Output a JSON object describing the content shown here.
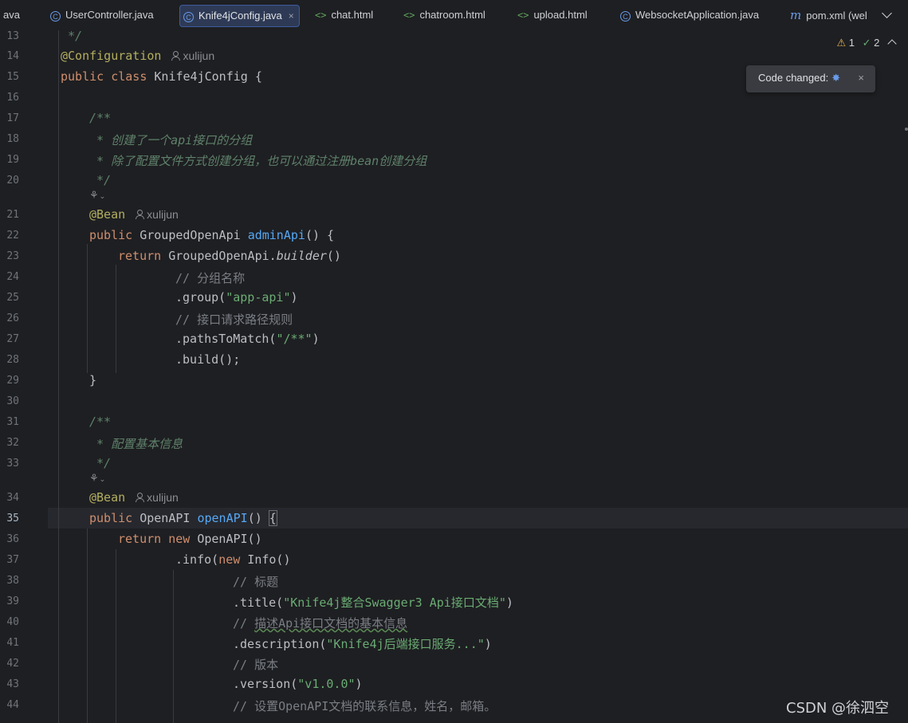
{
  "tabs": [
    {
      "label": "ava",
      "icon": "",
      "active": false
    },
    {
      "label": "UserController.java",
      "icon": "java-class-icon",
      "active": false
    },
    {
      "label": "Knife4jConfig.java",
      "icon": "java-class-icon",
      "active": true
    },
    {
      "label": "chat.html",
      "icon": "html-file-icon",
      "active": false
    },
    {
      "label": "chatroom.html",
      "icon": "html-file-icon",
      "active": false
    },
    {
      "label": "upload.html",
      "icon": "html-file-icon",
      "active": false
    },
    {
      "label": "WebsocketApplication.java",
      "icon": "java-class-icon",
      "active": false
    },
    {
      "label": "pom.xml (wel",
      "icon": "maven-icon",
      "active": false
    }
  ],
  "icons": {
    "class": "C",
    "html": "<>",
    "maven": "m",
    "close": "×",
    "lens": "⚘",
    "chevron": "⌄"
  },
  "inspections": {
    "warnings": "1",
    "checks": "2"
  },
  "toast": {
    "text": "Code changed:"
  },
  "watermark": "CSDN @徐泗空",
  "gutter": {
    "line_numbers": [
      "13",
      "14",
      "15",
      "16",
      "17",
      "18",
      "19",
      "20",
      "21",
      "22",
      "23",
      "24",
      "25",
      "26",
      "27",
      "28",
      "29",
      "30",
      "31",
      "32",
      "33",
      "34",
      "35",
      "36",
      "37",
      "38",
      "39",
      "40",
      "41",
      "42",
      "43",
      "44"
    ],
    "current_line": "35"
  },
  "code": {
    "l13": " */",
    "l14_ann": "@Configuration",
    "author": "xulijun",
    "l15_kw": "public class",
    "l15_rest": " Knife4jConfig {",
    "l17": "/**",
    "l18": " * 创建了一个api接口的分组",
    "l19": " * 除了配置文件方式创建分组，也可以通过注册bean创建分组",
    "l20": " */",
    "bean": "@Bean",
    "l22_kw": "public",
    "l22_type": " GroupedOpenApi ",
    "l22_fn": "adminApi",
    "l22_rest": "() {",
    "return_kw": "return",
    "l23_rest": " GroupedOpenApi.",
    "l23_it": "builder",
    "l23_end": "()",
    "l24": "// 分组名称",
    "l25_a": ".group(",
    "l25_s": "\"app-api\"",
    "l25_b": ")",
    "l26": "// 接口请求路径规则",
    "l27_a": ".pathsToMatch(",
    "l27_s": "\"/**\"",
    "l27_b": ")",
    "l28": ".build();",
    "l29": "}",
    "l31": "/**",
    "l32": " * 配置基本信息",
    "l33": " */",
    "l35_kw": "public",
    "l35_type": " OpenAPI ",
    "l35_fn": "openAPI",
    "l35_paren": "() ",
    "l35_brace": "{",
    "l36_new": "new",
    "l36_rest": " OpenAPI()",
    "l37_a": ".info(",
    "l37_new": "new",
    "l37_b": " Info()",
    "l38": "// 标题",
    "l39_a": ".title(",
    "l39_s": "\"Knife4j整合Swagger3 Api接口文档\"",
    "l39_b": ")",
    "l40_a": "// ",
    "l40_b": "描述Api接口文档的基本信息",
    "l41_a": ".description(",
    "l41_s": "\"Knife4j后端接口服务...\"",
    "l41_b": ")",
    "l42": "// 版本",
    "l43_a": ".version(",
    "l43_s": "\"v1.0.0\"",
    "l43_b": ")",
    "l44": "// 设置OpenAPI文档的联系信息，姓名，邮箱。"
  }
}
